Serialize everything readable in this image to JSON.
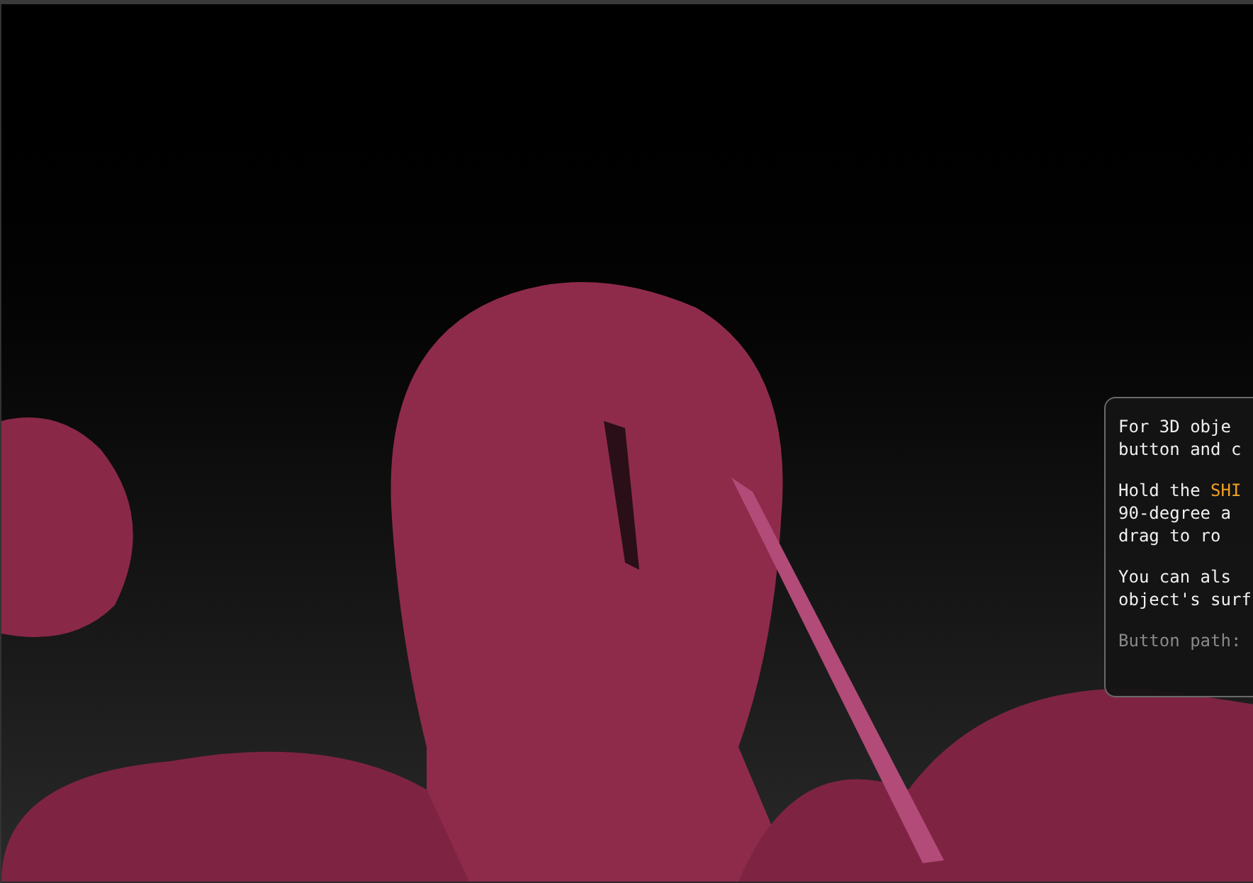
{
  "tooltip": {
    "paragraphs": [
      {
        "kind": "body",
        "lines": [
          {
            "text": "For 3D obje"
          },
          {
            "text": "button and c"
          }
        ]
      },
      {
        "kind": "body",
        "lines": [
          {
            "text": "Hold the ",
            "key": "SHI"
          },
          {
            "text": "90-degree a"
          },
          {
            "text": "drag to ro"
          }
        ]
      },
      {
        "kind": "body",
        "lines": [
          {
            "text": "You can als"
          },
          {
            "text": "object's surf"
          }
        ]
      },
      {
        "kind": "path",
        "lines": [
          {
            "text": "Button path:"
          }
        ]
      }
    ]
  }
}
